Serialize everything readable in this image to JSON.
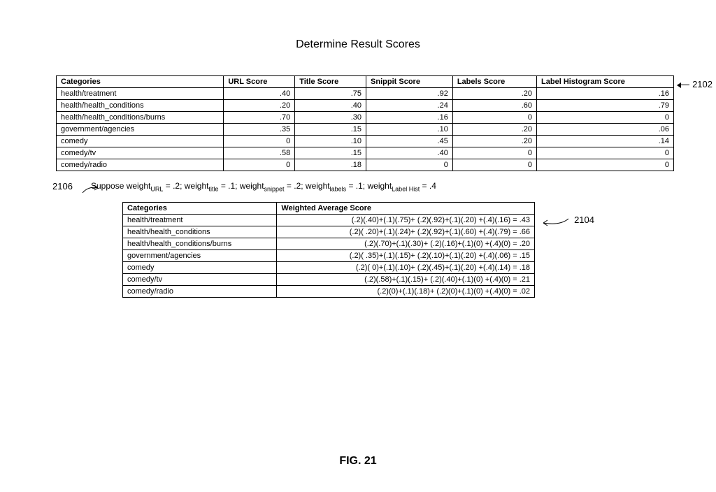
{
  "title": "Determine Result Scores",
  "figLabel": "FIG. 21",
  "ref2102": "2102",
  "ref2104": "2104",
  "ref2106": "2106",
  "table1": {
    "headers": [
      "Categories",
      "URL Score",
      "Title Score",
      "Snippit Score",
      "Labels Score",
      "Label Histogram Score"
    ],
    "rows": [
      {
        "cat": "health/treatment",
        "url": ".40",
        "title": ".75",
        "snip": ".92",
        "lab": ".20",
        "hist": ".16"
      },
      {
        "cat": "health/health_conditions",
        "url": ".20",
        "title": ".40",
        "snip": ".24",
        "lab": ".60",
        "hist": ".79"
      },
      {
        "cat": "health/health_conditions/burns",
        "url": ".70",
        "title": ".30",
        "snip": ".16",
        "lab": "0",
        "hist": "0"
      },
      {
        "cat": "government/agencies",
        "url": ".35",
        "title": ".15",
        "snip": ".10",
        "lab": ".20",
        "hist": ".06"
      },
      {
        "cat": "comedy",
        "url": "0",
        "title": ".10",
        "snip": ".45",
        "lab": ".20",
        "hist": ".14"
      },
      {
        "cat": "comedy/tv",
        "url": ".58",
        "title": ".15",
        "snip": ".40",
        "lab": "0",
        "hist": "0"
      },
      {
        "cat": "comedy/radio",
        "url": "0",
        "title": ".18",
        "snip": "0",
        "lab": "0",
        "hist": "0"
      }
    ]
  },
  "weights": {
    "lead": "Suppose weight",
    "url": " = .2; weight",
    "title": " = .1; weight",
    "snip": " = .2; weight",
    "lab": " = .1; weight",
    "hist": " = .4",
    "subURL": "URL",
    "subTitle": "title",
    "subSnip": "snippet",
    "subLab": "labels",
    "subHist": "Label Hist"
  },
  "table2": {
    "headers": [
      "Categories",
      "Weighted Average Score"
    ],
    "rows": [
      {
        "cat": "health/treatment",
        "expr": "(.2)(.40)+(.1)(.75)+ (.2)(.92)+(.1)(.20) +(.4)(.16) = .43"
      },
      {
        "cat": "health/health_conditions",
        "expr": "(.2)( .20)+(.1)(.24)+ (.2)(.92)+(.1)(.60) +(.4)(.79) = .66"
      },
      {
        "cat": "health/health_conditions/burns",
        "expr": "(.2)(.70)+(.1)(.30)+ (.2)(.16)+(.1)(0) +(.4)(0) = .20"
      },
      {
        "cat": "government/agencies",
        "expr": "(.2)( .35)+(.1)(.15)+ (.2)(.10)+(.1)(.20) +(.4)(.06) = .15"
      },
      {
        "cat": "comedy",
        "expr": "(.2)( 0)+(.1)(.10)+ (.2)(.45)+(.1)(.20) +(.4)(.14) = .18"
      },
      {
        "cat": "comedy/tv",
        "expr": "(.2)(.58)+(.1)(.15)+ (.2)(.40)+(.1)(0) +(.4)(0) = .21"
      },
      {
        "cat": "comedy/radio",
        "expr": "(.2)(0)+(.1)(.18)+ (.2)(0)+(.1)(0) +(.4)(0) = .02"
      }
    ]
  }
}
